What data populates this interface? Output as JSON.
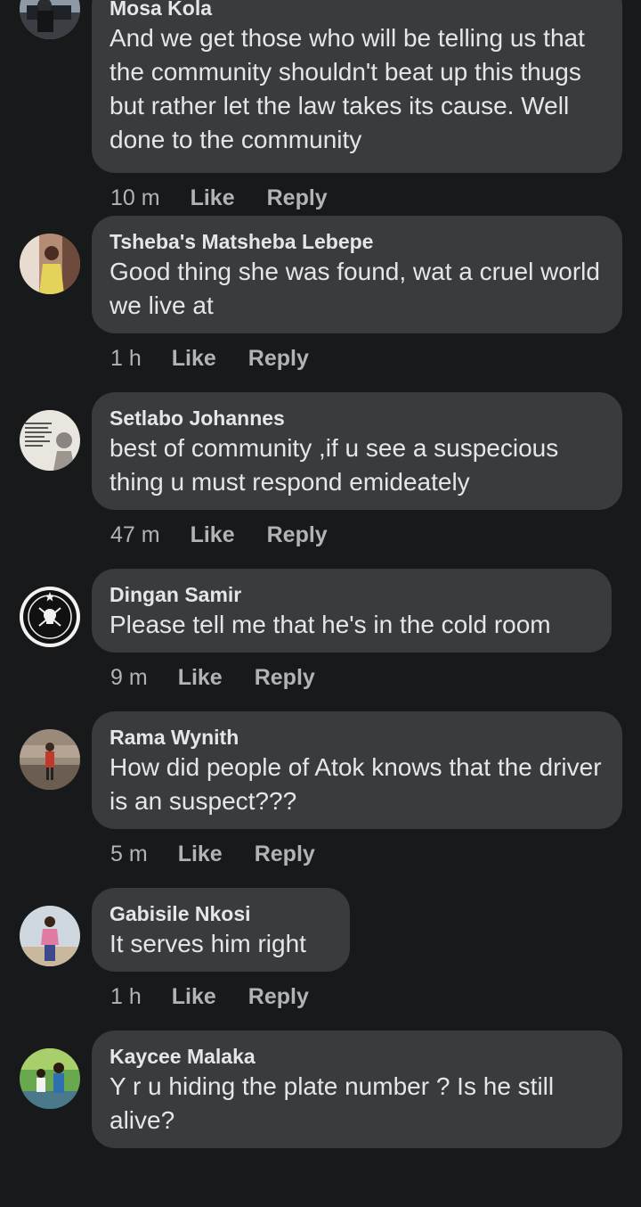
{
  "comments": [
    {
      "author": "Mosa Kola",
      "text": "And we get those who will be telling us that the community shouldn't beat up this thugs but rather let the law takes its cause. Well done to the community",
      "time": "10 m",
      "like_label": "Like",
      "reply_label": "Reply",
      "avatar_icon": "user-photo-icon"
    },
    {
      "author": "Tsheba's Matsheba Lebepe",
      "text": "Good thing she was found, wat a cruel world we live at",
      "time": "1 h",
      "like_label": "Like",
      "reply_label": "Reply",
      "avatar_icon": "user-photo-icon"
    },
    {
      "author": "Setlabo Johannes",
      "text": "best of community ,if u see a suspecious thing u must respond emideately",
      "time": "47 m",
      "like_label": "Like",
      "reply_label": "Reply",
      "avatar_icon": "quote-poster-icon"
    },
    {
      "author": "Dingan Samir",
      "text": "Please tell me that he's in the cold room",
      "time": "9 m",
      "like_label": "Like",
      "reply_label": "Reply",
      "avatar_icon": "orlando-pirates-logo-icon"
    },
    {
      "author": "Rama Wynith",
      "text": "How did people of Atok knows that the driver is an suspect???",
      "time": "5 m",
      "like_label": "Like",
      "reply_label": "Reply",
      "avatar_icon": "user-photo-icon"
    },
    {
      "author": "Gabisile Nkosi",
      "text": "It serves him right",
      "time": "1 h",
      "like_label": "Like",
      "reply_label": "Reply",
      "avatar_icon": "user-photo-icon"
    },
    {
      "author": "Kaycee Malaka",
      "text": "Y r u hiding the plate number ? Is he still alive?",
      "time": "",
      "like_label": "",
      "reply_label": "",
      "avatar_icon": "user-photo-icon"
    }
  ],
  "colors": {
    "background": "#18191a",
    "bubble": "#3a3b3c",
    "text_primary": "#e4e6eb",
    "text_secondary": "#b0b3b8"
  }
}
